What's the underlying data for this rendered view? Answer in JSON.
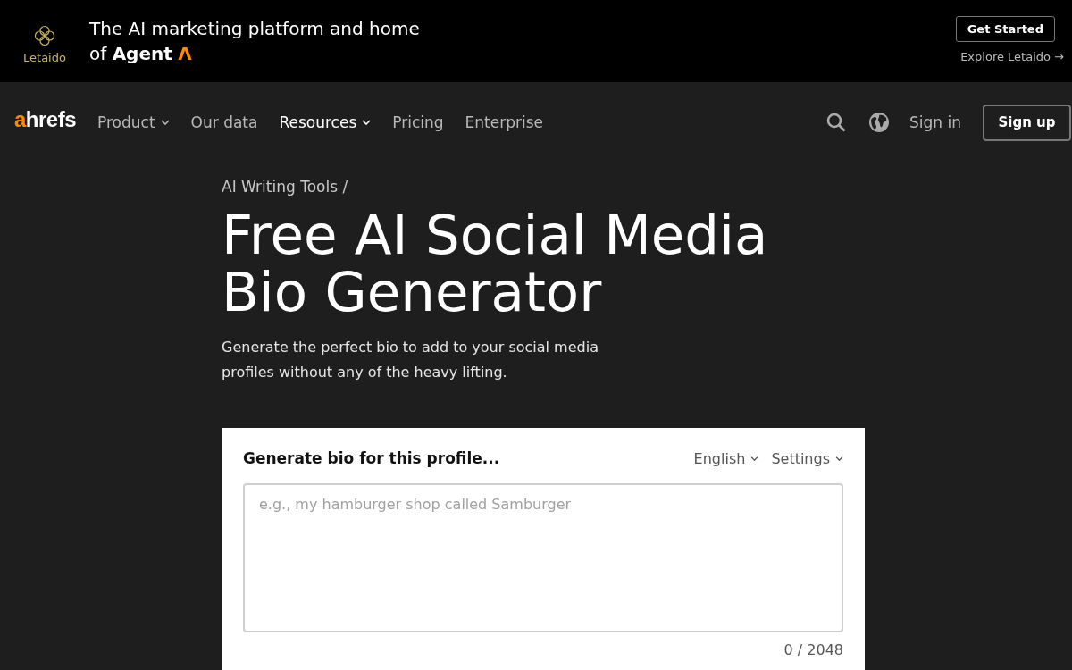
{
  "banner": {
    "logo": {
      "text": "Letaido"
    },
    "headline": "The AI marketing platform and home of",
    "brand": "Agent",
    "brand_mark": "Λ",
    "button": "Get Started",
    "link": "Explore Letaido →"
  },
  "nav": {
    "logo": {
      "accent": "a",
      "text": "hrefs"
    },
    "items": [
      {
        "label": "Product",
        "has_menu": true,
        "active": false
      },
      {
        "label": "Our data",
        "has_menu": false,
        "active": false
      },
      {
        "label": "Resources",
        "has_menu": true,
        "active": true
      },
      {
        "label": "Pricing",
        "has_menu": false,
        "active": false
      },
      {
        "label": "Enterprise",
        "has_menu": false,
        "active": false
      }
    ],
    "sign_in": "Sign in",
    "sign_up": "Sign up"
  },
  "breadcrumb": "AI Writing Tools /",
  "title": "Free AI Social Media Bio Generator",
  "subtitle": "Generate the perfect bio to add to your social media profiles without any of the heavy lifting.",
  "form": {
    "heading": "Generate bio for this profile...",
    "language": "English",
    "settings": "Settings",
    "placeholder": "e.g., my hamburger shop called Samburger",
    "counter": "0 / 2048"
  }
}
